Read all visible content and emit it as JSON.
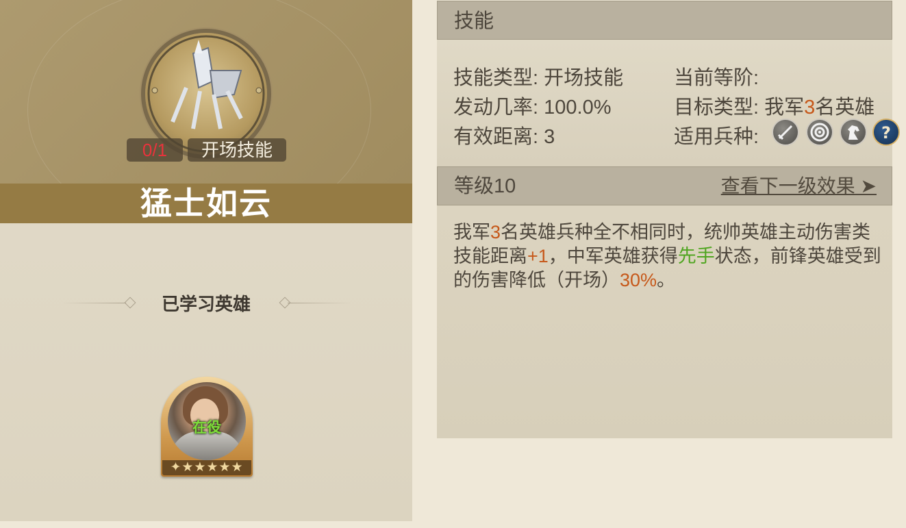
{
  "skill": {
    "name": "猛士如云",
    "count": "0/1",
    "type_badge": "开场技能",
    "learned_heroes_title": "已学习英雄",
    "hero": {
      "status": "在役",
      "stars": 5
    }
  },
  "skill_section": {
    "header": "技能",
    "type_label": "技能类型:",
    "type_value": "开场技能",
    "current_rank_label": "当前等阶:",
    "current_rank_value": "",
    "chance_label": "发动几率:",
    "chance_value": "100.0%",
    "target_label": "目标类型:",
    "target_prefix": "我军",
    "target_num": "3",
    "target_suffix": "名英雄",
    "range_label": "有效距离:",
    "range_value": "3",
    "troops_label": "适用兵种:",
    "troop_icons": [
      "sword-icon",
      "bow-target-icon",
      "horse-icon",
      "question-icon"
    ]
  },
  "level_section": {
    "header": "等级10",
    "next_link": "查看下一级效果 ➤",
    "desc": {
      "p1": "我军",
      "n1": "3",
      "p2": "名英雄兵种全不相同时，统帅英雄主动伤害类技能距离",
      "n2": "+1",
      "p3": "，中军英雄获得",
      "g1": "先手",
      "p4": "状态，前锋英雄受到的伤害降低（开场）",
      "n3": "30%",
      "p5": "。"
    }
  },
  "colors": {
    "accent_orange": "#c6581a",
    "accent_green": "#4fa520",
    "count_red": "#e8333c",
    "title_bar": "#957b44"
  }
}
